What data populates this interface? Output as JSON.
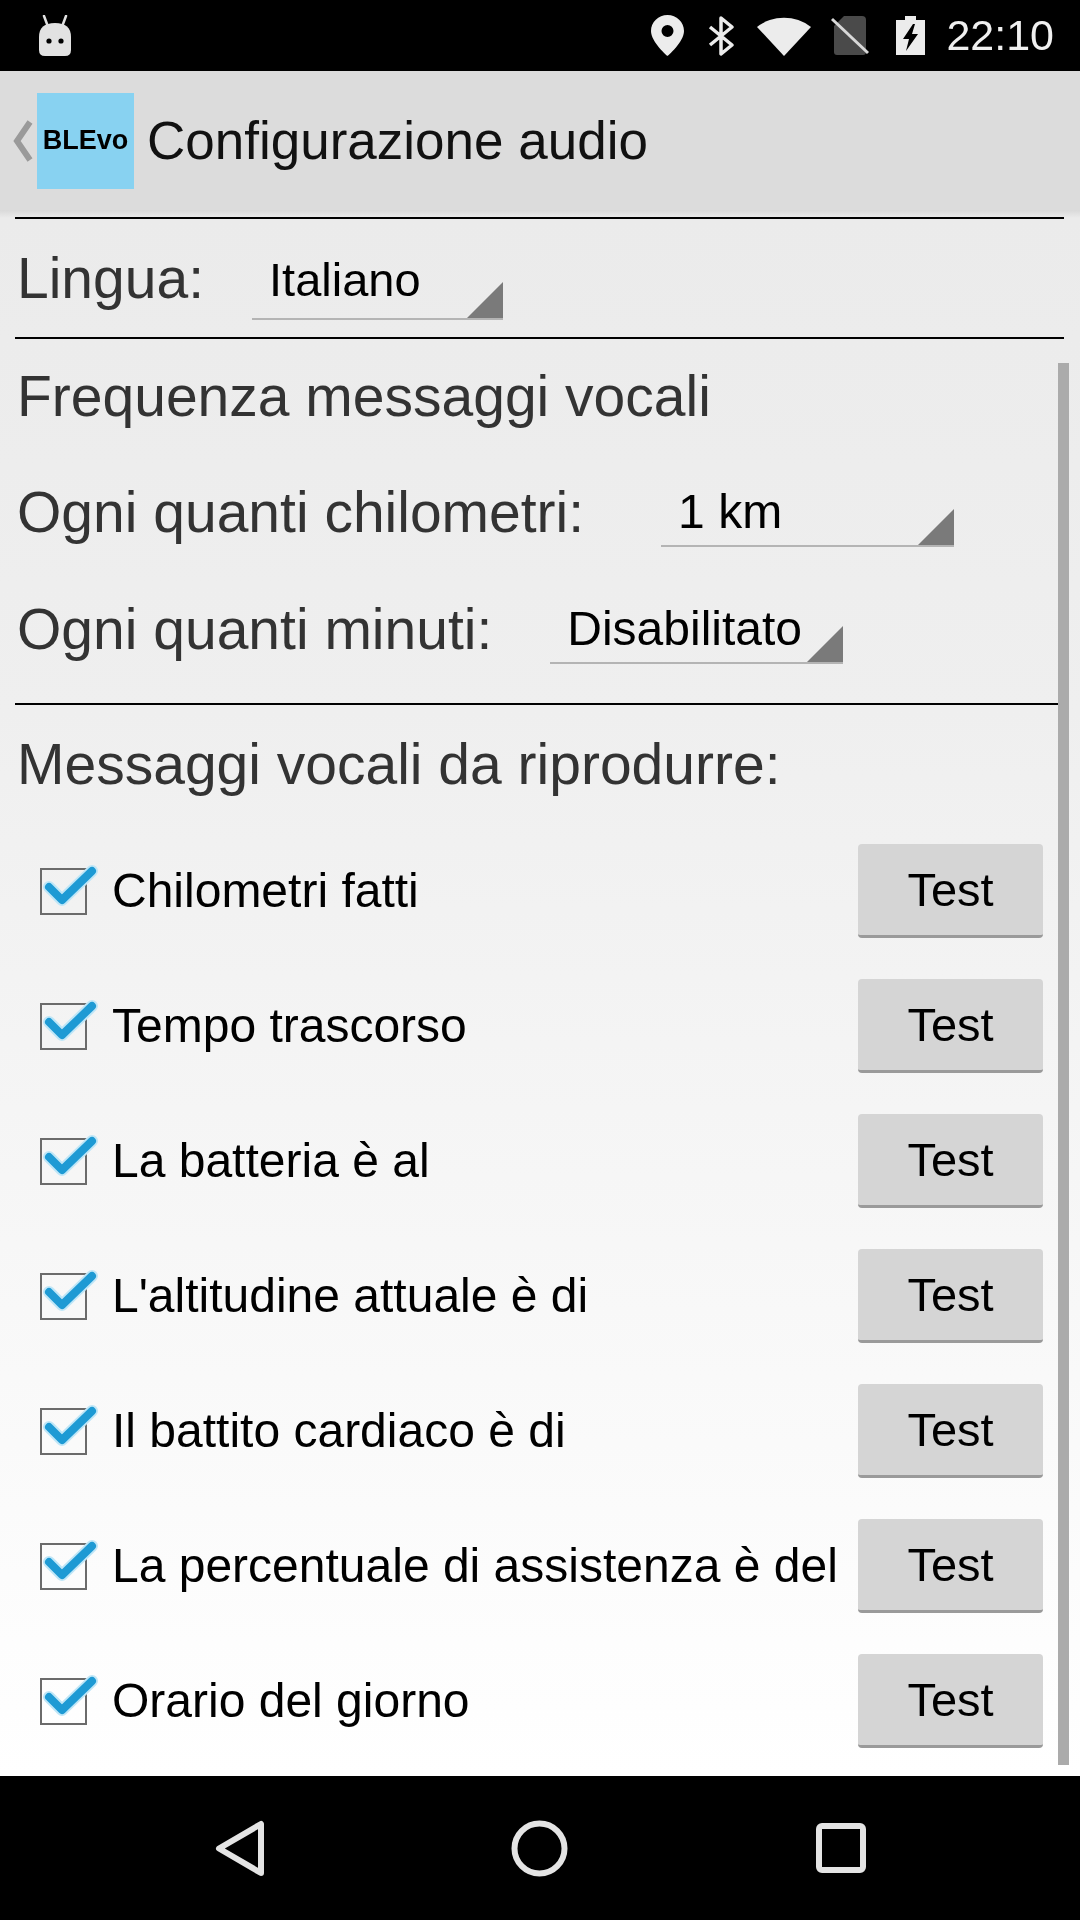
{
  "status_bar": {
    "time": "22:10"
  },
  "action_bar": {
    "logo": "BLEvo",
    "title": "Configurazione audio"
  },
  "language": {
    "label": "Lingua:",
    "value": "Italiano"
  },
  "frequency": {
    "heading": "Frequenza messaggi vocali",
    "settings": [
      {
        "label": "Ogni quanti chilometri:",
        "value": "1 km"
      },
      {
        "label": "Ogni quanti minuti:",
        "value": "Disabilitato"
      }
    ]
  },
  "messages": {
    "heading": "Messaggi vocali da riprodurre:",
    "items": [
      {
        "label": "Chilometri fatti",
        "checked": true,
        "button": "Test"
      },
      {
        "label": "Tempo trascorso",
        "checked": true,
        "button": "Test"
      },
      {
        "label": "La batteria è al",
        "checked": true,
        "button": "Test"
      },
      {
        "label": "L'altitudine attuale è di",
        "checked": true,
        "button": "Test"
      },
      {
        "label": "Il battito cardiaco è di",
        "checked": true,
        "button": "Test"
      },
      {
        "label": "La percentuale di assistenza è del",
        "checked": true,
        "button": "Test"
      },
      {
        "label": "Orario del giorno",
        "checked": true,
        "button": "Test"
      }
    ]
  }
}
